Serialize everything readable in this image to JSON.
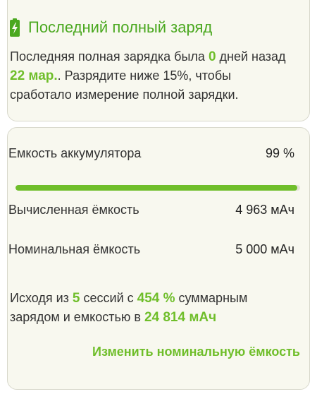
{
  "last_charge": {
    "title": "Последний полный заряд",
    "icon": "battery-charging-icon",
    "text_1": "Последняя полная зарядка была ",
    "days": "0",
    "text_2": " дней назад ",
    "date": "22 мар.",
    "text_3": ". Разрядите ниже ",
    "threshold": "15%,",
    "text_4": " чтобы сработало измерение полной зарядки."
  },
  "capacity": {
    "battery_capacity_label": "Емкость аккумулятора",
    "battery_capacity_value": "99 %",
    "battery_capacity_fraction": 0.99,
    "calculated_label": "Вычисленная ёмкость",
    "calculated_value": "4 963 мАч",
    "nominal_label": "Номинальная ёмкость",
    "nominal_value": "5 000 мАч",
    "summary_1": "Исходя из ",
    "sessions": "5",
    "summary_2": " сессий с ",
    "total_charge": "454 %",
    "summary_3": " суммарным зарядом и емкостью в ",
    "total_capacity": "24 814 мАч",
    "change_link": "Изменить номинальную ёмкость"
  },
  "colors": {
    "accent": "#6fbe2a",
    "title_accent": "#4aa81f",
    "card_bg": "#f8f8ef"
  }
}
